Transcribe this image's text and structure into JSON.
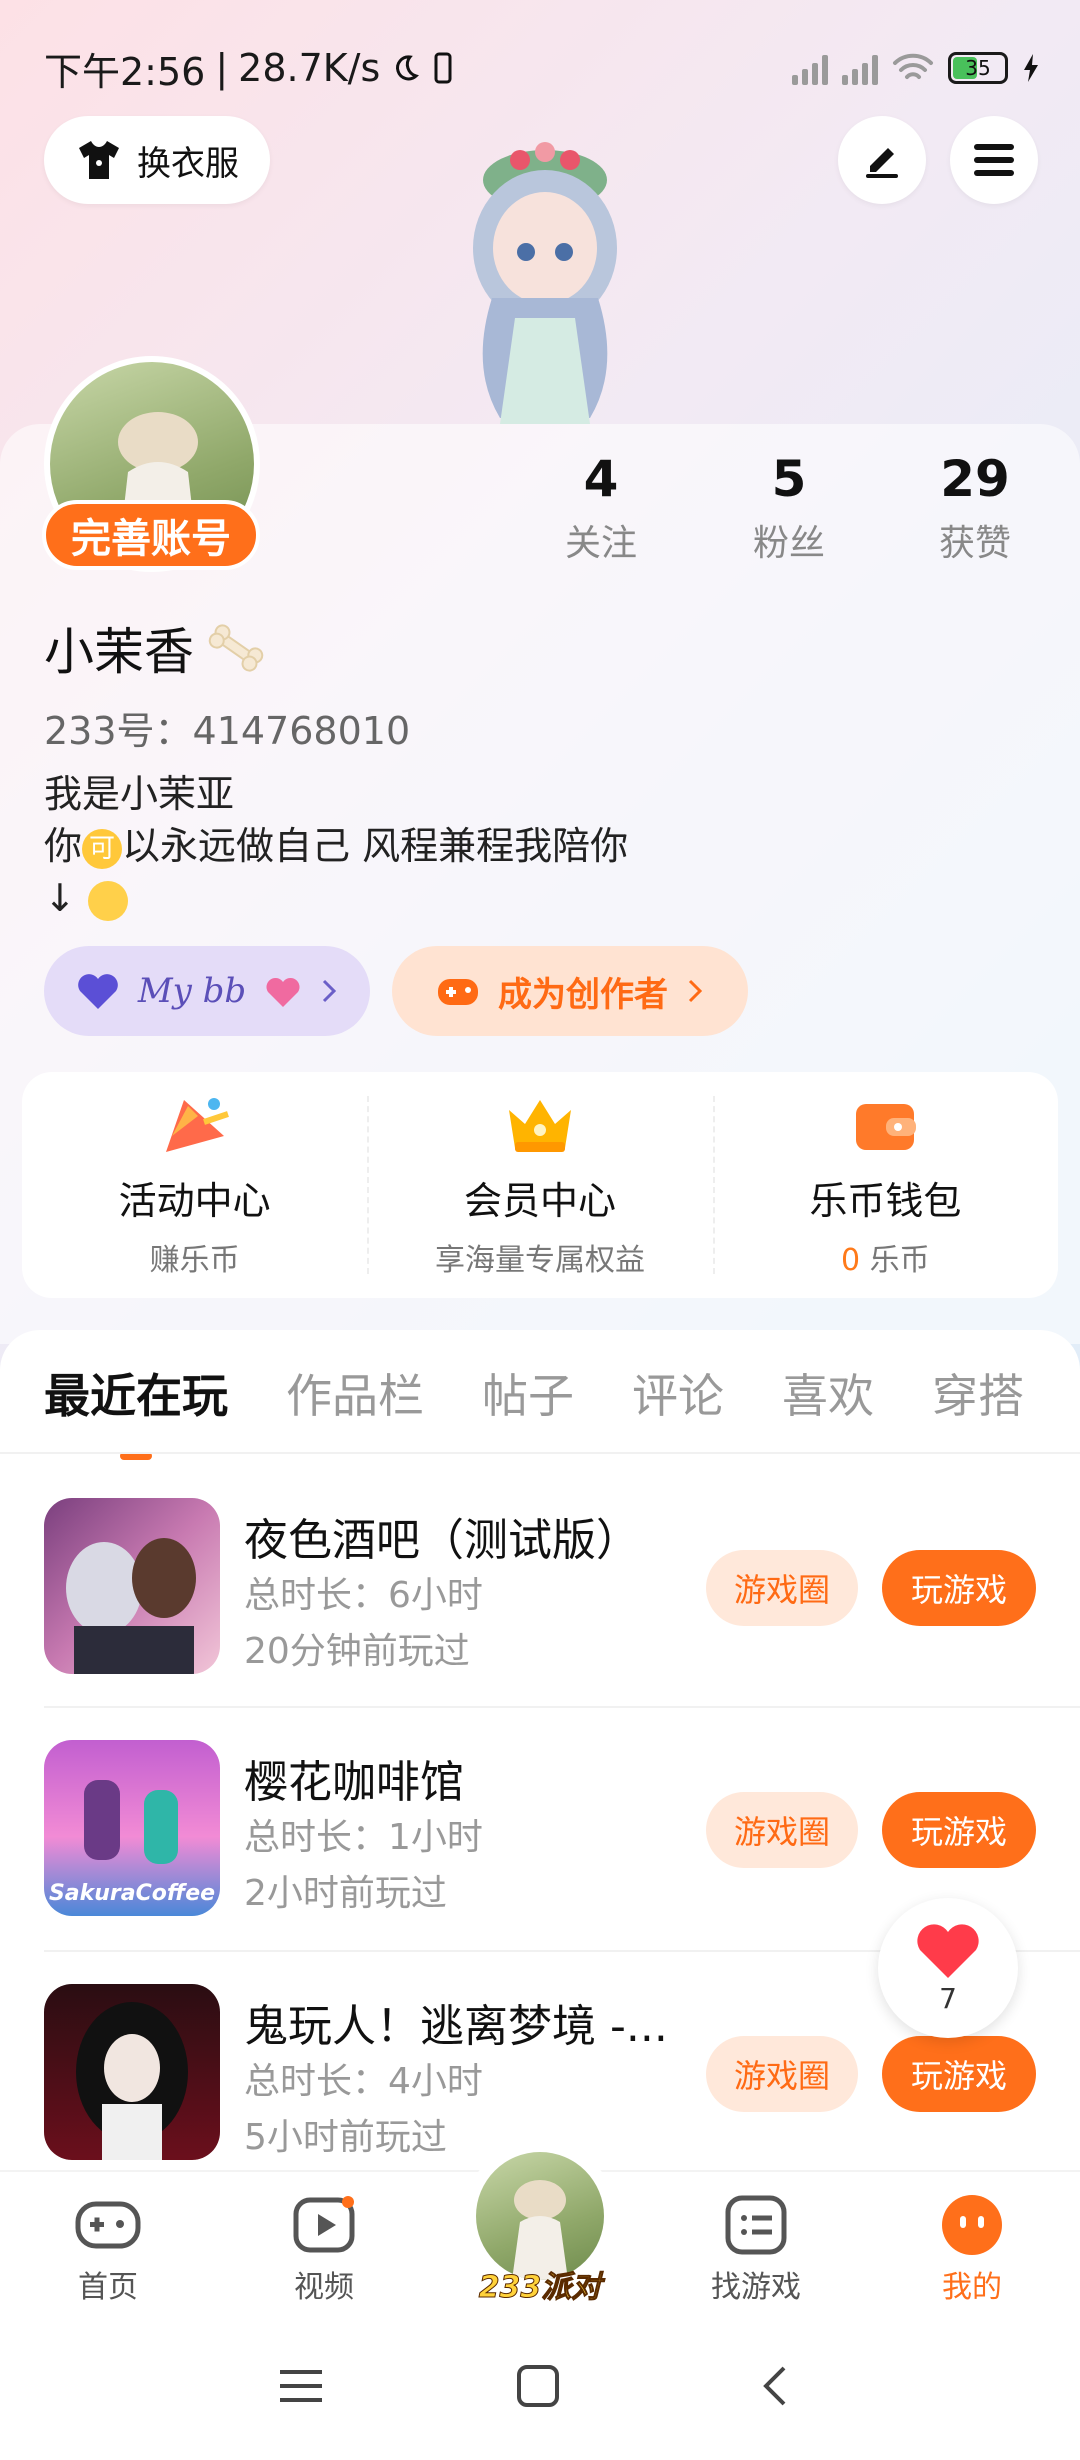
{
  "status_bar": {
    "time": "下午2:56",
    "speed": "28.7K/s",
    "battery": "35"
  },
  "header": {
    "outfit_label": "换衣服"
  },
  "profile": {
    "complete_label": "完善账号",
    "stats": [
      {
        "num": "4",
        "label": "关注"
      },
      {
        "num": "5",
        "label": "粉丝"
      },
      {
        "num": "29",
        "label": "获赞"
      }
    ],
    "username": "小茉香",
    "uid": "233号：414768010",
    "bio_lines": [
      "我是小茉亚",
      "你",
      "以永远做自己 风程兼程我陪你",
      "↓"
    ],
    "bio_emoji": "可",
    "pill_mybb": "My bb",
    "pill_creator": "成为创作者"
  },
  "features": [
    {
      "title": "活动中心",
      "sub": "赚乐币"
    },
    {
      "title": "会员中心",
      "sub": "享海量专属权益"
    },
    {
      "title": "乐币钱包",
      "sub_num": "0",
      "sub_unit": "乐币"
    }
  ],
  "tabs": [
    "最近在玩",
    "作品栏",
    "帖子",
    "评论",
    "喜欢",
    "穿搭"
  ],
  "games": [
    {
      "name": "夜色酒吧（测试版）",
      "duration": "总时长：6小时",
      "last_played": "20分钟前玩过",
      "circle_label": "游戏圈",
      "play_label": "玩游戏"
    },
    {
      "name": "樱花咖啡馆",
      "duration": "总时长：1小时",
      "last_played": "2小时前玩过",
      "circle_label": "游戏圈",
      "play_label": "玩游戏",
      "thumb_text": "SakuraCoffee"
    },
    {
      "name": "鬼玩人！逃离梦境 -...",
      "duration": "总时长：4小时",
      "last_played": "5小时前玩过",
      "circle_label": "游戏圈",
      "play_label": "玩游戏"
    }
  ],
  "like_count": "7",
  "bottom_nav": [
    {
      "label": "首页"
    },
    {
      "label": "视频"
    },
    {
      "label": "233派对"
    },
    {
      "label": "找游戏"
    },
    {
      "label": "我的"
    }
  ],
  "colors": {
    "accent": "#ff6f1a",
    "accent_light": "#ffe8da"
  }
}
